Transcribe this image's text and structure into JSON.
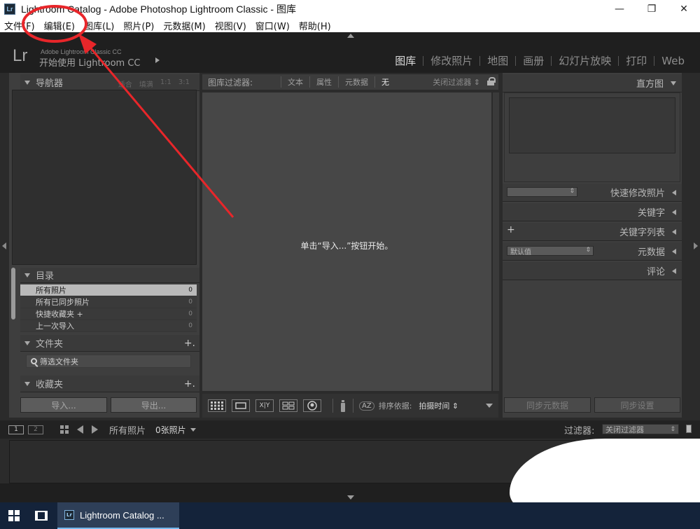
{
  "window": {
    "title": "Lightroom Catalog - Adobe Photoshop Lightroom Classic - 图库",
    "logo": "Lr",
    "controls": [
      "minimize-icon",
      "restore-icon",
      "close-icon"
    ],
    "minimize_glyph": "—",
    "restore_glyph": "❐",
    "close_glyph": "✕"
  },
  "menu": {
    "items": [
      "文件(F)",
      "编辑(E)",
      "图库(L)",
      "照片(P)",
      "元数据(M)",
      "视图(V)",
      "窗口(W)",
      "帮助(H)"
    ]
  },
  "identity": {
    "logo": "Lr",
    "small": "Adobe Lightroom Classic CC",
    "large": "开始使用 Lightroom CC"
  },
  "modules": {
    "items": [
      "图库",
      "修改照片",
      "地图",
      "画册",
      "幻灯片放映",
      "打印",
      "Web"
    ],
    "active": "图库"
  },
  "left": {
    "navigator": {
      "title": "导航器",
      "zoom": [
        "适合",
        "填满",
        "1:1",
        "3:1"
      ]
    },
    "catalog": {
      "title": "目录",
      "rows": [
        {
          "label": "所有照片",
          "count": "0"
        },
        {
          "label": "所有已同步照片",
          "count": "0"
        },
        {
          "label": "快捷收藏夹 +",
          "count": "0"
        },
        {
          "label": "上一次导入",
          "count": "0"
        }
      ]
    },
    "folders": {
      "title": "文件夹",
      "filter_placeholder": "筛选文件夹",
      "plus": "+."
    },
    "collections": {
      "title": "收藏夹",
      "plus": "+."
    },
    "import_label": "导入...",
    "export_label": "导出..."
  },
  "center": {
    "filter": {
      "title": "图库过滤器:",
      "options": [
        "文本",
        "属性",
        "元数据",
        "无"
      ],
      "active": "无",
      "close": "关闭过滤器 ⇕"
    },
    "empty_message": "单击“导入...”按钮开始。",
    "toolbar": {
      "compare_label": "X|Y",
      "sort_icon_label": "AZ",
      "sort_label": "排序依据:",
      "sort_value": "拍摄时间 ⇕"
    }
  },
  "right": {
    "histogram_title": "直方图",
    "quick_develop": {
      "title": "快速修改照片",
      "preset": ""
    },
    "keywording": {
      "title": "关键字"
    },
    "keyword_list": {
      "title": "关键字列表",
      "plus": "+"
    },
    "metadata": {
      "title": "元数据",
      "preset": "默认值"
    },
    "comments": {
      "title": "评论"
    },
    "sync_metadata_label": "同步元数据",
    "sync_settings_label": "同步设置"
  },
  "filmstrip": {
    "pages": [
      "1",
      "2"
    ],
    "source": "所有照片",
    "count": "0张照片",
    "filter_label": "过滤器:",
    "filter_value": "关闭过滤器"
  },
  "taskbar": {
    "app_label": "Lightroom Catalog ...",
    "app_icon": "Lr"
  },
  "colors": {
    "annotation": "#e8262a",
    "active_tab_underline": "#76b9ed"
  }
}
